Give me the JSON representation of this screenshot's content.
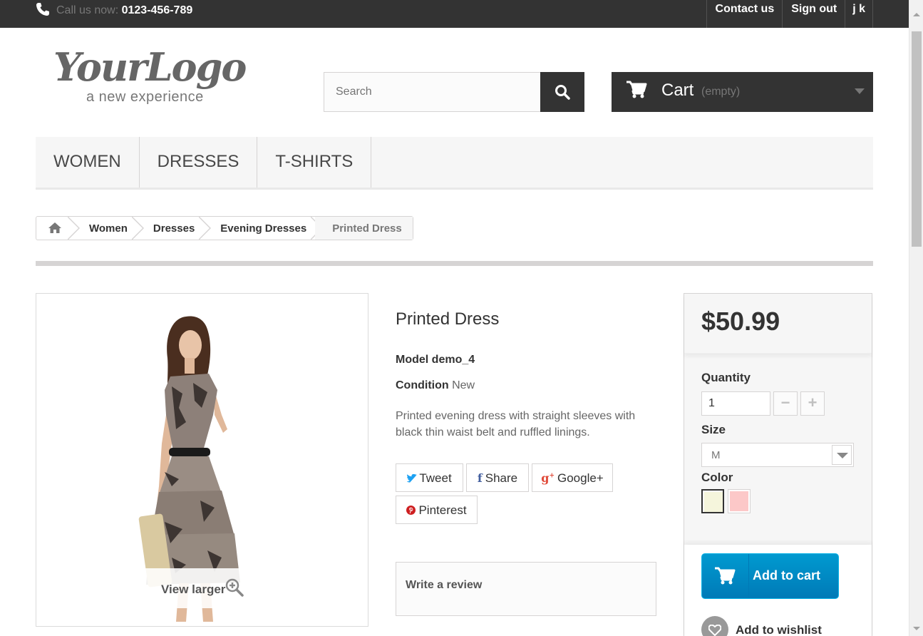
{
  "topbar": {
    "call_label": "Call us now:",
    "phone": "0123-456-789",
    "links": [
      "Contact us",
      "Sign out",
      "j k"
    ]
  },
  "logo": {
    "script": "YourLogo",
    "tagline": "a new experience"
  },
  "search": {
    "placeholder": "Search"
  },
  "cart": {
    "label": "Cart",
    "status": "(empty)"
  },
  "menu": {
    "items": [
      "WOMEN",
      "DRESSES",
      "T-SHIRTS"
    ]
  },
  "breadcrumb": {
    "items": [
      "Women",
      "Dresses",
      "Evening Dresses",
      "Printed Dress"
    ]
  },
  "product": {
    "image_action": "View larger",
    "title": "Printed Dress",
    "model_label": "Model",
    "model_value": "demo_4",
    "condition_label": "Condition",
    "condition_value": "New",
    "description": "Printed evening dress with straight sleeves with black thin waist belt and ruffled linings.",
    "share": {
      "tweet": "Tweet",
      "share": "Share",
      "googleplus": "Google+",
      "pinterest": "Pinterest"
    },
    "review_label": "Write a review"
  },
  "buybox": {
    "price": "$50.99",
    "quantity_label": "Quantity",
    "quantity_value": "1",
    "minus": "−",
    "plus": "+",
    "size_label": "Size",
    "size_value": "M",
    "color_label": "Color",
    "colors": [
      "#f5f5dc",
      "#fcc8c8"
    ],
    "add_to_cart": "Add to cart",
    "wishlist": "Add to wishlist"
  },
  "icons": {
    "phone": "phone-icon",
    "search": "search-icon",
    "cart": "cart-icon",
    "home": "home-icon",
    "zoom": "zoom-in-icon",
    "heart": "heart-icon"
  }
}
